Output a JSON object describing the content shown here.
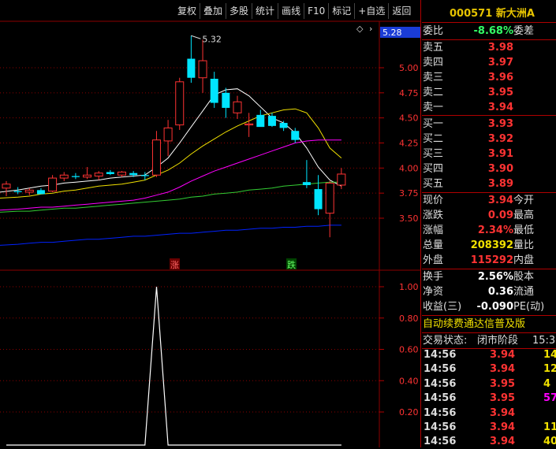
{
  "toolbar": [
    "复权",
    "叠加",
    "多股",
    "统计",
    "画线",
    "F10",
    "标记",
    "+自选",
    "返回"
  ],
  "stock": {
    "code": "000571",
    "name": "新大洲A"
  },
  "price_tag": "5.28",
  "peak_label": "5.32",
  "chart_marks": {
    "up": "涨",
    "down": "跌"
  },
  "colors": {
    "up": "#ff3333",
    "down": "#00e5ff",
    "ma5": "#ffffff",
    "ma10": "#f0e000",
    "ma20": "#ff00ff",
    "ma60": "#33cc33",
    "ma120": "#0022ff",
    "grid": "#8b0000"
  },
  "chart_data": [
    {
      "type": "candlestick",
      "ylim": [
        3.3,
        5.4
      ],
      "y_ticks": [
        "5.00",
        "4.75",
        "4.50",
        "4.25",
        "4.00",
        "3.75",
        "3.50"
      ],
      "candles": [
        {
          "o": 3.8,
          "h": 3.87,
          "l": 3.72,
          "c": 3.84
        },
        {
          "o": 3.77,
          "h": 3.81,
          "l": 3.74,
          "c": 3.76
        },
        {
          "o": 3.76,
          "h": 3.8,
          "l": 3.73,
          "c": 3.78
        },
        {
          "o": 3.78,
          "h": 3.8,
          "l": 3.74,
          "c": 3.74
        },
        {
          "o": 3.77,
          "h": 3.93,
          "l": 3.76,
          "c": 3.9
        },
        {
          "o": 3.9,
          "h": 3.96,
          "l": 3.87,
          "c": 3.93
        },
        {
          "o": 3.92,
          "h": 3.95,
          "l": 3.89,
          "c": 3.91
        },
        {
          "o": 3.91,
          "h": 4.01,
          "l": 3.89,
          "c": 3.93
        },
        {
          "o": 3.92,
          "h": 3.97,
          "l": 3.88,
          "c": 3.95
        },
        {
          "o": 3.96,
          "h": 3.98,
          "l": 3.93,
          "c": 3.94
        },
        {
          "o": 3.93,
          "h": 3.97,
          "l": 3.91,
          "c": 3.96
        },
        {
          "o": 3.95,
          "h": 3.97,
          "l": 3.91,
          "c": 3.93
        },
        {
          "o": 3.93,
          "h": 3.96,
          "l": 3.88,
          "c": 3.92
        },
        {
          "o": 3.93,
          "h": 4.37,
          "l": 3.91,
          "c": 4.28
        },
        {
          "o": 4.27,
          "h": 4.48,
          "l": 4.12,
          "c": 4.4
        },
        {
          "o": 4.43,
          "h": 4.9,
          "l": 4.38,
          "c": 4.86
        },
        {
          "o": 5.09,
          "h": 5.32,
          "l": 4.85,
          "c": 4.9
        },
        {
          "o": 4.9,
          "h": 5.28,
          "l": 4.75,
          "c": 5.07
        },
        {
          "o": 4.89,
          "h": 4.96,
          "l": 4.6,
          "c": 4.65
        },
        {
          "o": 4.75,
          "h": 4.8,
          "l": 4.5,
          "c": 4.6
        },
        {
          "o": 4.55,
          "h": 4.72,
          "l": 4.49,
          "c": 4.66
        },
        {
          "o": 4.43,
          "h": 4.55,
          "l": 4.31,
          "c": 4.44
        },
        {
          "o": 4.53,
          "h": 4.58,
          "l": 4.44,
          "c": 4.41
        },
        {
          "o": 4.52,
          "h": 4.55,
          "l": 4.41,
          "c": 4.42
        },
        {
          "o": 4.45,
          "h": 4.47,
          "l": 4.37,
          "c": 4.4
        },
        {
          "o": 4.37,
          "h": 4.4,
          "l": 4.25,
          "c": 4.28
        },
        {
          "o": 3.86,
          "h": 4.08,
          "l": 3.8,
          "c": 3.83
        },
        {
          "o": 3.79,
          "h": 3.93,
          "l": 3.53,
          "c": 3.59
        },
        {
          "o": 3.55,
          "h": 3.87,
          "l": 3.31,
          "c": 3.85
        },
        {
          "o": 3.83,
          "h": 4.0,
          "l": 3.79,
          "c": 3.94
        }
      ],
      "ma_lines": [
        {
          "name": "MA5",
          "values": [
            3.76,
            3.78,
            3.8,
            3.82,
            3.83,
            3.85,
            3.86,
            3.87,
            3.88,
            3.9,
            3.91,
            3.92,
            3.93,
            4.01,
            4.1,
            4.25,
            4.41,
            4.57,
            4.73,
            4.78,
            4.79,
            4.72,
            4.61,
            4.5,
            4.45,
            4.35,
            4.2,
            4.01,
            3.88,
            3.82
          ]
        },
        {
          "name": "MA10",
          "values": [
            3.7,
            3.71,
            3.72,
            3.74,
            3.75,
            3.77,
            3.78,
            3.8,
            3.82,
            3.83,
            3.84,
            3.86,
            3.88,
            3.93,
            3.98,
            4.05,
            4.14,
            4.22,
            4.29,
            4.36,
            4.42,
            4.47,
            4.52,
            4.55,
            4.58,
            4.59,
            4.55,
            4.4,
            4.2,
            4.1
          ]
        },
        {
          "name": "MA20",
          "values": [
            3.58,
            3.59,
            3.6,
            3.61,
            3.61,
            3.62,
            3.63,
            3.64,
            3.65,
            3.66,
            3.67,
            3.68,
            3.7,
            3.73,
            3.76,
            3.81,
            3.87,
            3.92,
            3.97,
            4.01,
            4.05,
            4.09,
            4.13,
            4.17,
            4.21,
            4.25,
            4.27,
            4.28,
            4.28,
            4.28
          ]
        },
        {
          "name": "MA60",
          "values": [
            3.56,
            3.57,
            3.57,
            3.58,
            3.59,
            3.6,
            3.6,
            3.61,
            3.62,
            3.63,
            3.64,
            3.65,
            3.66,
            3.67,
            3.68,
            3.69,
            3.71,
            3.72,
            3.74,
            3.75,
            3.76,
            3.78,
            3.79,
            3.8,
            3.82,
            3.83,
            3.84,
            3.85,
            3.86,
            3.86
          ]
        },
        {
          "name": "MA120",
          "values": [
            3.23,
            3.24,
            3.25,
            3.26,
            3.26,
            3.27,
            3.28,
            3.29,
            3.29,
            3.3,
            3.31,
            3.32,
            3.32,
            3.33,
            3.34,
            3.35,
            3.35,
            3.36,
            3.37,
            3.38,
            3.38,
            3.39,
            3.4,
            3.4,
            3.41,
            3.41,
            3.42,
            3.42,
            3.43,
            3.43
          ]
        }
      ]
    },
    {
      "type": "line",
      "ylim": [
        0,
        1.1
      ],
      "y_ticks": [
        "1.00",
        "0.80",
        "0.60",
        "0.40",
        "0.20"
      ],
      "color": "#ffffff",
      "values": [
        0,
        0,
        0,
        0,
        0,
        0,
        0,
        0,
        0,
        0,
        0,
        0,
        0,
        1.0,
        0,
        0,
        0,
        0,
        0,
        0,
        0,
        0,
        0,
        0,
        0,
        0,
        0,
        0,
        0,
        0
      ]
    }
  ],
  "order_ratio": {
    "label": "委比",
    "value": "-8.68%",
    "label2": "委差"
  },
  "sell": [
    {
      "label": "卖五",
      "price": "3.98"
    },
    {
      "label": "卖四",
      "price": "3.97"
    },
    {
      "label": "卖三",
      "price": "3.96"
    },
    {
      "label": "卖二",
      "price": "3.95"
    },
    {
      "label": "卖一",
      "price": "3.94"
    }
  ],
  "buy": [
    {
      "label": "买一",
      "price": "3.93"
    },
    {
      "label": "买二",
      "price": "3.92"
    },
    {
      "label": "买三",
      "price": "3.91"
    },
    {
      "label": "买四",
      "price": "3.90"
    },
    {
      "label": "买五",
      "price": "3.89"
    }
  ],
  "quote": [
    {
      "label": "现价",
      "value": "3.94",
      "label2": "今开",
      "cls": "red"
    },
    {
      "label": "涨跌",
      "value": "0.09",
      "label2": "最高",
      "cls": "red"
    },
    {
      "label": "涨幅",
      "value": "2.34%",
      "label2": "最低",
      "cls": "red"
    },
    {
      "label": "总量",
      "value": "208392",
      "label2": "量比",
      "cls": "yellow"
    },
    {
      "label": "外盘",
      "value": "115292",
      "label2": "内盘",
      "cls": "red"
    }
  ],
  "stats": [
    {
      "label": "换手",
      "value": "2.56%",
      "label2": "股本"
    },
    {
      "label": "净资",
      "value": "0.36",
      "label2": "流通"
    },
    {
      "label": "收益(三)",
      "value": "-0.090",
      "label2": "PE(动)"
    }
  ],
  "promo": "自动续费通达信普及版",
  "trade_state": {
    "label": "交易状态:",
    "value": "闭市阶段",
    "time": "15:3"
  },
  "ticks": [
    {
      "time": "14:56",
      "price": "3.94",
      "vol": "14",
      "cls": "yellow"
    },
    {
      "time": "14:56",
      "price": "3.94",
      "vol": "12",
      "cls": "yellow"
    },
    {
      "time": "14:56",
      "price": "3.95",
      "vol": "4",
      "cls": "yellow"
    },
    {
      "time": "14:56",
      "price": "3.95",
      "vol": "57",
      "cls": "magenta"
    },
    {
      "time": "14:56",
      "price": "3.94",
      "vol": "",
      "cls": "yellow"
    },
    {
      "time": "14:56",
      "price": "3.94",
      "vol": "11",
      "cls": "yellow"
    },
    {
      "time": "14:56",
      "price": "3.94",
      "vol": "40",
      "cls": "yellow"
    }
  ]
}
